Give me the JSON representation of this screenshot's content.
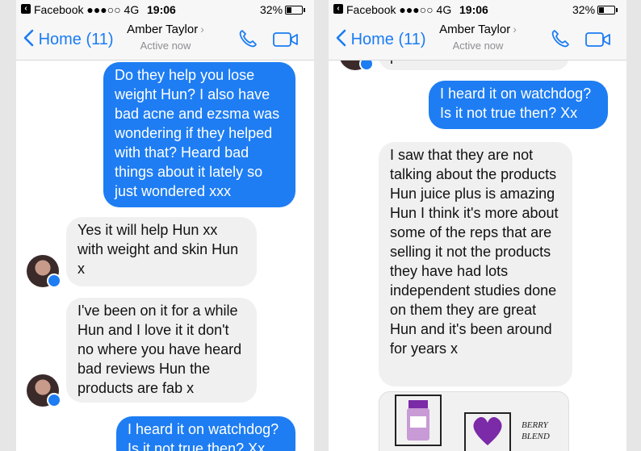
{
  "status_bar": {
    "app": "Facebook",
    "signal": "●●●○○",
    "network": "4G",
    "time": "19:06",
    "battery": "32%",
    "battery_level": 0.32
  },
  "nav": {
    "back_label": "Home (11)",
    "contact_name": "Amber Taylor",
    "contact_status": "Active now"
  },
  "left_messages": [
    "Do they help you lose weight Hun? I also have bad acne and ezsma was wondering if they helped with that? Heard bad things about it lately so just wondered xxx",
    "Yes it will help Hun xx with weight and skin Hun x",
    "I've been on it for a while Hun and I love it it don't no where you have heard bad reviews Hun the products are fab x",
    "I heard it on watchdog? Is it not true then? Xx"
  ],
  "right_messages": [
    "products are fab x",
    "I heard it on watchdog? Is it not true then? Xx",
    "I saw that they are not talking about the products Hun juice  plus is amazing Hun I think it's more about some of the reps that are selling it not the products they have had lots independent studies done on them they are great Hun and it's been around for years x"
  ],
  "photo_caption": "BERRY BLEND",
  "colors": {
    "accent": "#1e7df3",
    "incoming_bubble": "#f1f0f0",
    "nav_bg": "#f7f7f7",
    "purple": "#7b2aa8"
  },
  "icons": [
    "facebook-icon",
    "back-chevron-icon",
    "phone-call-icon",
    "video-call-icon",
    "messenger-badge-icon"
  ]
}
